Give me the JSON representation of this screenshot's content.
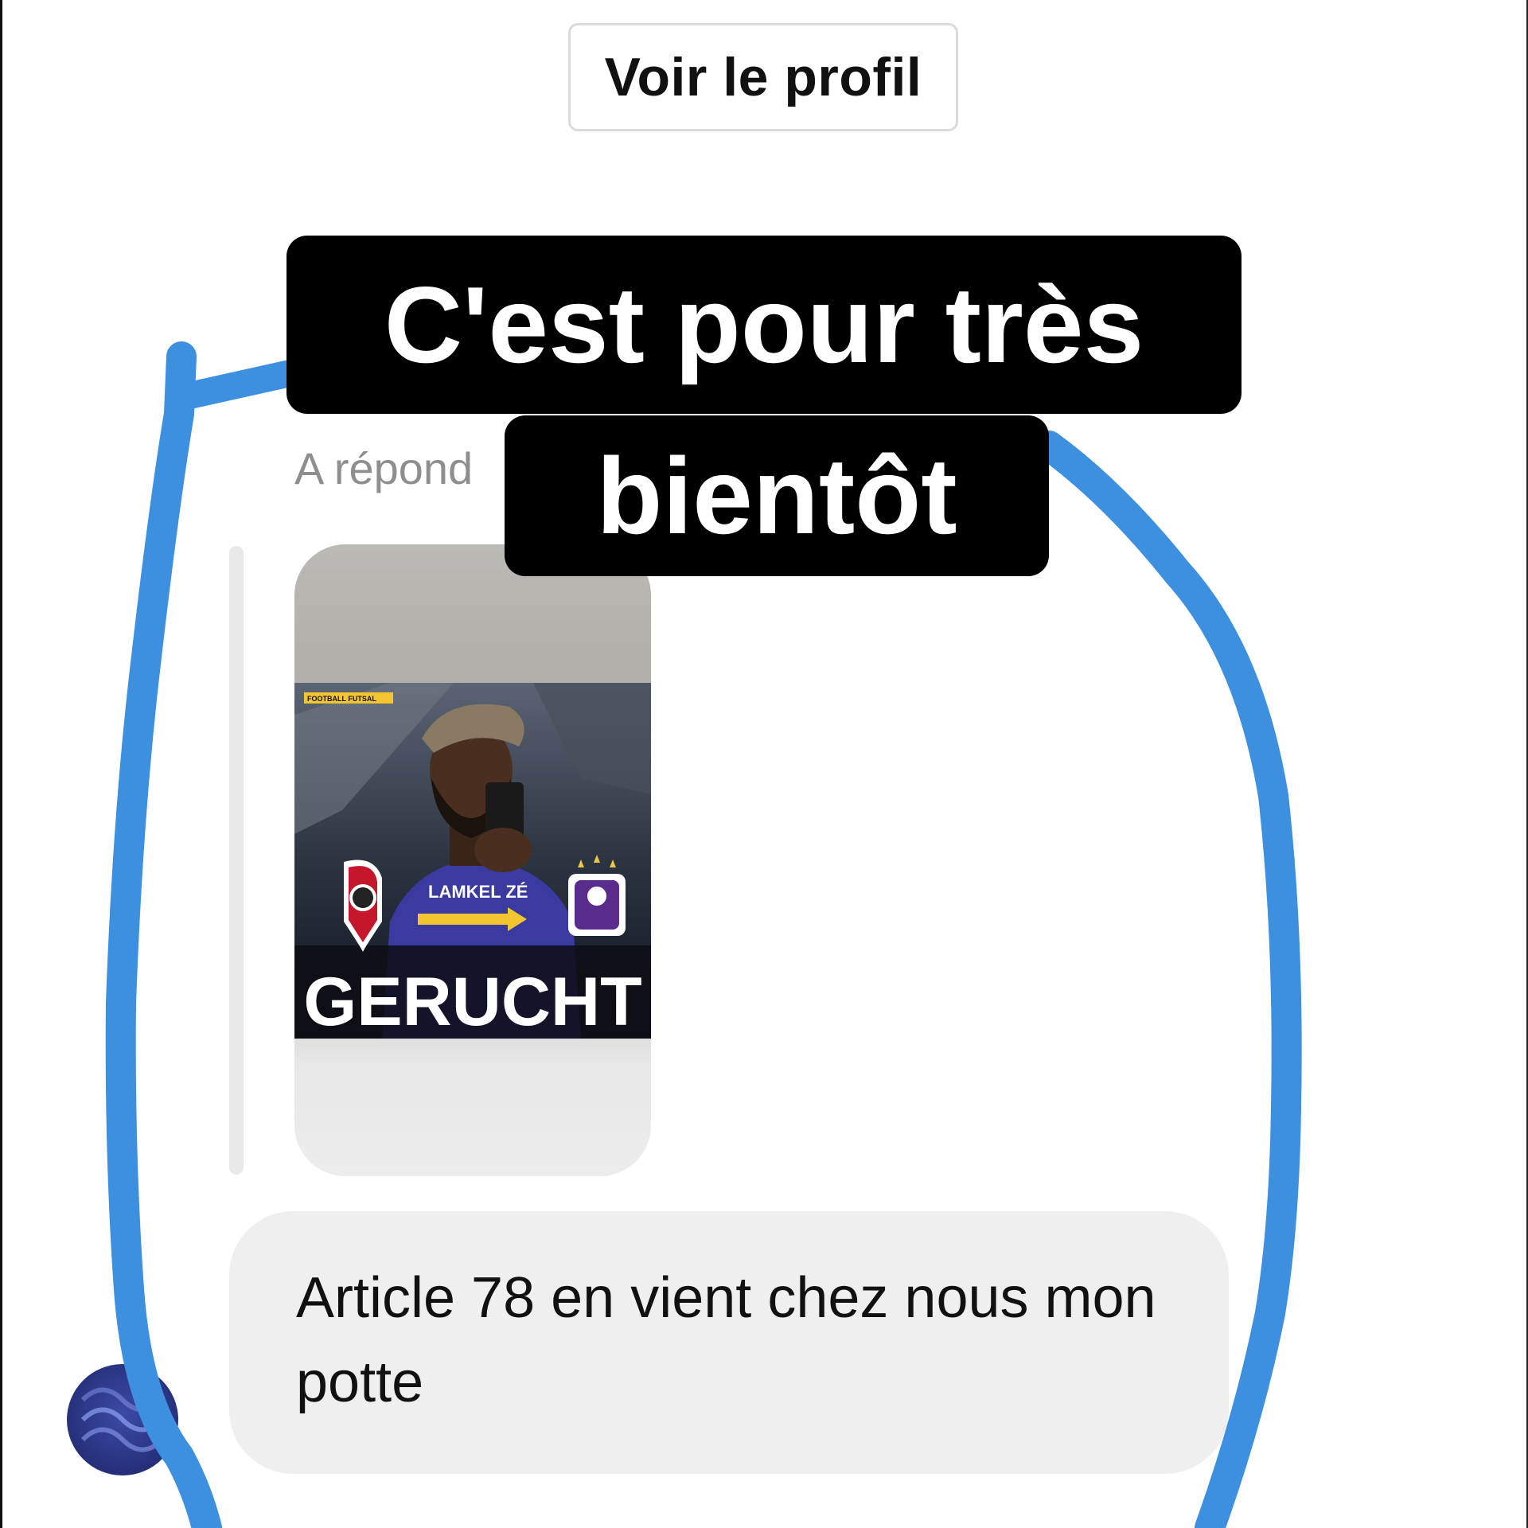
{
  "header": {
    "view_profile_label": "Voir le profil"
  },
  "story_reply": {
    "label": "A répond",
    "image_text": {
      "badge": "FOOTBALL  FUTSAL",
      "player": "LAMKEL ZÉ",
      "headline": "GERUCHT"
    }
  },
  "message": {
    "text": "Article 78 en vient chez nous mon potte"
  },
  "story_overlay": {
    "line1": "C'est pour très",
    "line2": "bientôt"
  },
  "colors": {
    "annotation": "#3d8fe0",
    "bubble": "#efefef",
    "overlay": "#000000"
  }
}
